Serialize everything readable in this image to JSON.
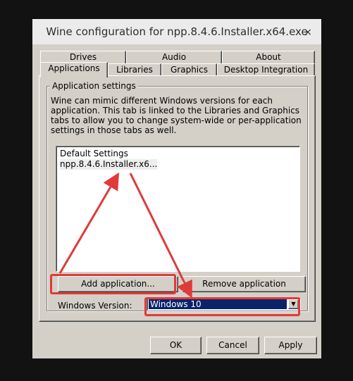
{
  "window": {
    "title": "Wine configuration for npp.8.4.6.Installer.x64.exe",
    "close_icon": "×"
  },
  "tabs": {
    "row1": [
      {
        "label": "Drives"
      },
      {
        "label": "Audio"
      },
      {
        "label": "About"
      }
    ],
    "row2": [
      {
        "label": "Applications",
        "active": true
      },
      {
        "label": "Libraries"
      },
      {
        "label": "Graphics"
      },
      {
        "label": "Desktop Integration"
      }
    ]
  },
  "app_settings": {
    "group_label": "Application settings",
    "description": "Wine can mimic different Windows versions for each application. This tab is linked to the Libraries and Graphics tabs to allow you to change system-wide or per-application settings in those tabs as well.",
    "list": [
      "Default Settings",
      "npp.8.4.6.Installer.x6..."
    ],
    "add_label": "Add application...",
    "remove_label": "Remove application",
    "windows_version_label": "Windows Version:",
    "windows_version_value": "Windows 10"
  },
  "footer": {
    "ok_label": "OK",
    "cancel_label": "Cancel",
    "apply_label": "Apply"
  },
  "colors": {
    "annotation": "#e03a3a",
    "selection": "#0a246a"
  }
}
